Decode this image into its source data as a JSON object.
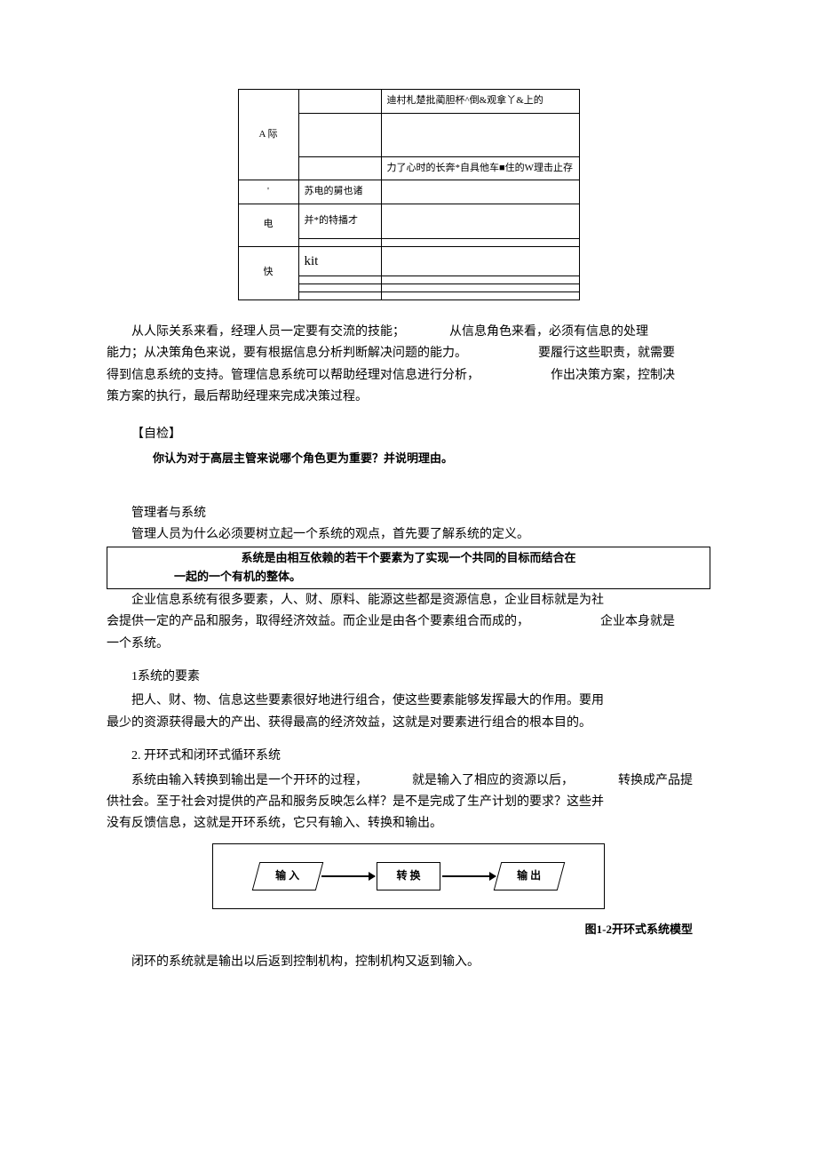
{
  "table": {
    "r1c1": "A 际",
    "r1c3": "迪村札楚批蔺胆杯^倒&观拿丫&上的",
    "r3c3": "力了心时的长奔*自具他车■住的W理击止存",
    "r4c1": "'",
    "r4c2": "苏电的舅也诸",
    "r5c1": "电",
    "r5c2": "并*的特播才",
    "r7c1": "快",
    "r7c2": "kit"
  },
  "p1a": "从人际关系来看，经理人员一定要有交流的技能；",
  "p1b": "从信息角色来看，必须有信息的处理",
  "p2a": "能力；从决策角色来说，要有根据信息分析判断解决问题的能力。",
  "p2b": "要履行这些职责，就需要",
  "p3a": "得到信息系统的支持。管理信息系统可以帮助经理对信息进行分析，",
  "p3b": "作出决策方案，控制决",
  "p4": "策方案的执行，最后帮助经理来完成决策过程。",
  "selfcheck_head": "【自检】",
  "selfcheck_q": "你认为对于高层主管来说哪个角色更为重要？并说明理由。",
  "mgr_sys_head": "管理者与系统",
  "mgr_sys_intro": "管理人员为什么必须要树立起一个系统的观点，首先要了解系统的定义。",
  "def_line1": "系统是由相互依赖的若干个要素为了实现一个共同的目标而结合在",
  "def_line2": "一起的一个有机的整体。",
  "p5": "企业信息系统有很多要素，人、财、原料、能源这些都是资源信息，企业目标就是为社",
  "p6a": "会提供一定的产品和服务，取得经济效益。而企业是由各个要素组合而成的，",
  "p6b": "企业本身就是",
  "p7": "一个系统。",
  "sec1_head": "1系统的要素",
  "sec1_p1": "把人、财、物、信息这些要素很好地进行组合，使这些要素能够发挥最大的作用。要用",
  "sec1_p2": "最少的资源获得最大的产出、获得最高的经济效益，这就是对要素进行组合的根本目的。",
  "sec2_head": "2. 开环式和闭环式循环系统",
  "sec2_p1a": "系统由输入转换到输出是一个开环的过程，",
  "sec2_p1b": "就是输入了相应的资源以后，",
  "sec2_p1c": "转换成产品提",
  "sec2_p2": "供社会。至于社会对提供的产品和服务反映怎么样？是不是完成了生产计划的要求？这些并",
  "sec2_p3": "没有反馈信息，这就是开环系统，它只有输入、转换和输出。",
  "diagram": {
    "input": "输 入",
    "process": "转 换",
    "output": "输 出"
  },
  "caption": "图1-2开环式系统模型",
  "closing": "闭环的系统就是输出以后返到控制机构，控制机构又返到输入。"
}
